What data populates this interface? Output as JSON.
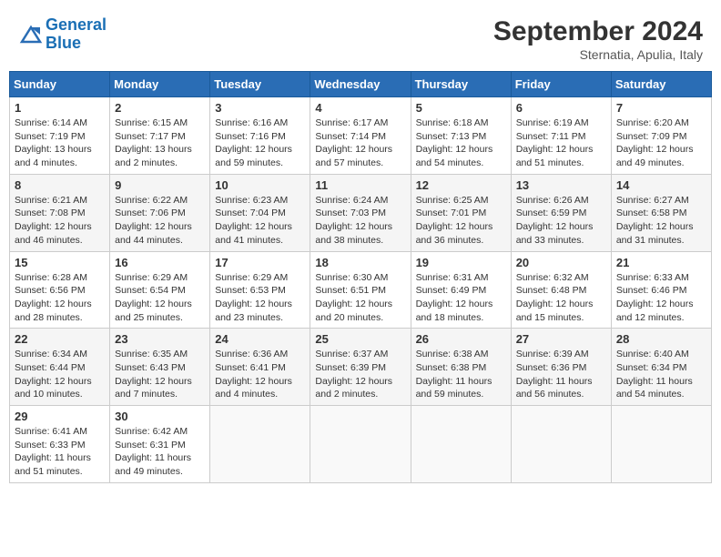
{
  "header": {
    "logo_line1": "General",
    "logo_line2": "Blue",
    "month": "September 2024",
    "location": "Sternatia, Apulia, Italy"
  },
  "days_of_week": [
    "Sunday",
    "Monday",
    "Tuesday",
    "Wednesday",
    "Thursday",
    "Friday",
    "Saturday"
  ],
  "weeks": [
    [
      {
        "day": "1",
        "text": "Sunrise: 6:14 AM\nSunset: 7:19 PM\nDaylight: 13 hours\nand 4 minutes."
      },
      {
        "day": "2",
        "text": "Sunrise: 6:15 AM\nSunset: 7:17 PM\nDaylight: 13 hours\nand 2 minutes."
      },
      {
        "day": "3",
        "text": "Sunrise: 6:16 AM\nSunset: 7:16 PM\nDaylight: 12 hours\nand 59 minutes."
      },
      {
        "day": "4",
        "text": "Sunrise: 6:17 AM\nSunset: 7:14 PM\nDaylight: 12 hours\nand 57 minutes."
      },
      {
        "day": "5",
        "text": "Sunrise: 6:18 AM\nSunset: 7:13 PM\nDaylight: 12 hours\nand 54 minutes."
      },
      {
        "day": "6",
        "text": "Sunrise: 6:19 AM\nSunset: 7:11 PM\nDaylight: 12 hours\nand 51 minutes."
      },
      {
        "day": "7",
        "text": "Sunrise: 6:20 AM\nSunset: 7:09 PM\nDaylight: 12 hours\nand 49 minutes."
      }
    ],
    [
      {
        "day": "8",
        "text": "Sunrise: 6:21 AM\nSunset: 7:08 PM\nDaylight: 12 hours\nand 46 minutes."
      },
      {
        "day": "9",
        "text": "Sunrise: 6:22 AM\nSunset: 7:06 PM\nDaylight: 12 hours\nand 44 minutes."
      },
      {
        "day": "10",
        "text": "Sunrise: 6:23 AM\nSunset: 7:04 PM\nDaylight: 12 hours\nand 41 minutes."
      },
      {
        "day": "11",
        "text": "Sunrise: 6:24 AM\nSunset: 7:03 PM\nDaylight: 12 hours\nand 38 minutes."
      },
      {
        "day": "12",
        "text": "Sunrise: 6:25 AM\nSunset: 7:01 PM\nDaylight: 12 hours\nand 36 minutes."
      },
      {
        "day": "13",
        "text": "Sunrise: 6:26 AM\nSunset: 6:59 PM\nDaylight: 12 hours\nand 33 minutes."
      },
      {
        "day": "14",
        "text": "Sunrise: 6:27 AM\nSunset: 6:58 PM\nDaylight: 12 hours\nand 31 minutes."
      }
    ],
    [
      {
        "day": "15",
        "text": "Sunrise: 6:28 AM\nSunset: 6:56 PM\nDaylight: 12 hours\nand 28 minutes."
      },
      {
        "day": "16",
        "text": "Sunrise: 6:29 AM\nSunset: 6:54 PM\nDaylight: 12 hours\nand 25 minutes."
      },
      {
        "day": "17",
        "text": "Sunrise: 6:29 AM\nSunset: 6:53 PM\nDaylight: 12 hours\nand 23 minutes."
      },
      {
        "day": "18",
        "text": "Sunrise: 6:30 AM\nSunset: 6:51 PM\nDaylight: 12 hours\nand 20 minutes."
      },
      {
        "day": "19",
        "text": "Sunrise: 6:31 AM\nSunset: 6:49 PM\nDaylight: 12 hours\nand 18 minutes."
      },
      {
        "day": "20",
        "text": "Sunrise: 6:32 AM\nSunset: 6:48 PM\nDaylight: 12 hours\nand 15 minutes."
      },
      {
        "day": "21",
        "text": "Sunrise: 6:33 AM\nSunset: 6:46 PM\nDaylight: 12 hours\nand 12 minutes."
      }
    ],
    [
      {
        "day": "22",
        "text": "Sunrise: 6:34 AM\nSunset: 6:44 PM\nDaylight: 12 hours\nand 10 minutes."
      },
      {
        "day": "23",
        "text": "Sunrise: 6:35 AM\nSunset: 6:43 PM\nDaylight: 12 hours\nand 7 minutes."
      },
      {
        "day": "24",
        "text": "Sunrise: 6:36 AM\nSunset: 6:41 PM\nDaylight: 12 hours\nand 4 minutes."
      },
      {
        "day": "25",
        "text": "Sunrise: 6:37 AM\nSunset: 6:39 PM\nDaylight: 12 hours\nand 2 minutes."
      },
      {
        "day": "26",
        "text": "Sunrise: 6:38 AM\nSunset: 6:38 PM\nDaylight: 11 hours\nand 59 minutes."
      },
      {
        "day": "27",
        "text": "Sunrise: 6:39 AM\nSunset: 6:36 PM\nDaylight: 11 hours\nand 56 minutes."
      },
      {
        "day": "28",
        "text": "Sunrise: 6:40 AM\nSunset: 6:34 PM\nDaylight: 11 hours\nand 54 minutes."
      }
    ],
    [
      {
        "day": "29",
        "text": "Sunrise: 6:41 AM\nSunset: 6:33 PM\nDaylight: 11 hours\nand 51 minutes."
      },
      {
        "day": "30",
        "text": "Sunrise: 6:42 AM\nSunset: 6:31 PM\nDaylight: 11 hours\nand 49 minutes."
      },
      {
        "day": "",
        "text": ""
      },
      {
        "day": "",
        "text": ""
      },
      {
        "day": "",
        "text": ""
      },
      {
        "day": "",
        "text": ""
      },
      {
        "day": "",
        "text": ""
      }
    ]
  ]
}
